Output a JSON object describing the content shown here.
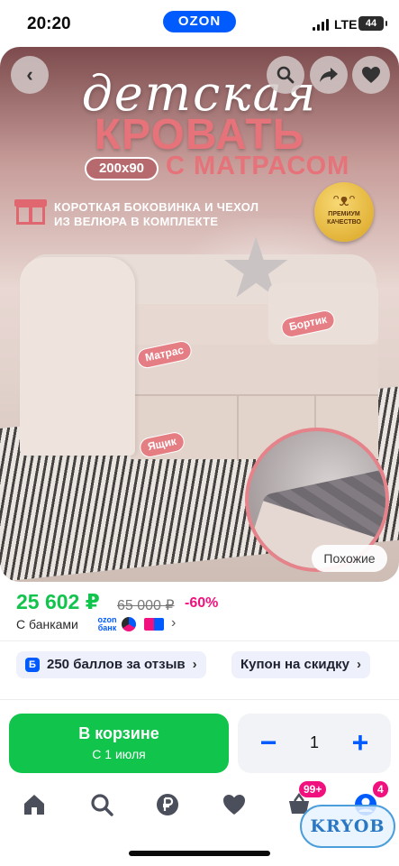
{
  "status_bar": {
    "time": "20:20",
    "brand": "OZON",
    "network": "LTE",
    "battery": "44"
  },
  "hero": {
    "title_script": "детская",
    "title_main": "КРОВАТЬ",
    "size_badge": "200x90",
    "title_sub": "С МАТРАСОМ",
    "feature_line_1": "КОРОТКАЯ БОКОВИНКА И ЧЕХОЛ",
    "feature_line_2": "ИЗ ВЕЛЮРА В КОМПЛЕКТЕ",
    "premium_line_1": "ПРЕМИУМ",
    "premium_line_2": "КАЧЕСТВО",
    "label_mattress": "Матрас",
    "label_rail": "Бортик",
    "label_drawer": "Ящик",
    "similar_label": "Похожие",
    "back_icon": "back-arrow-icon",
    "search_icon": "search-icon",
    "share_icon": "share-icon",
    "favorite_icon": "heart-icon"
  },
  "price": {
    "current": "25 602 ₽",
    "old": "65 000 ₽",
    "discount": "-60%",
    "banks_label": "С банками",
    "ozon_bank_line_1": "ozon",
    "ozon_bank_line_2": "банк",
    "chevron": "›"
  },
  "chips": {
    "points_badge": "Б",
    "points_label": "250 баллов за отзыв",
    "coupon_label": "Купон на скидку",
    "chevron": "›"
  },
  "cart": {
    "button_title": "В корзине",
    "button_subtitle": "С 1 июля",
    "quantity": "1",
    "minus": "−",
    "plus": "+"
  },
  "tab_bar": {
    "items": [
      "home-icon",
      "search-icon",
      "ruble-icon",
      "heart-icon",
      "cart-icon",
      "profile-icon"
    ],
    "cart_badge": "99+",
    "profile_badge": "4"
  },
  "watermark": "KRYOB",
  "colors": {
    "accent_blue": "#005bff",
    "green": "#10c44c",
    "pink": "#f1117e",
    "hero_pink": "#e6727a"
  }
}
